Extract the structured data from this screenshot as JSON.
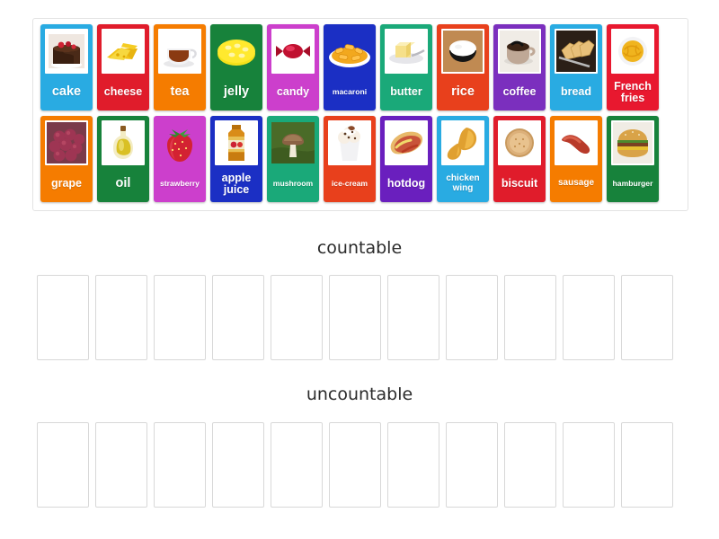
{
  "activity": {
    "type": "group-sort",
    "background_color": "#ffffff"
  },
  "tray": {
    "name": "card-tray",
    "rows": [
      [
        {
          "label": "cake",
          "icon": "cake-icon",
          "color": "#29abe2",
          "label_size": "s-lg",
          "photo_bg": "#ffffff"
        },
        {
          "label": "cheese",
          "icon": "cheese-icon",
          "color": "#e01c2b",
          "label_size": "s-md",
          "photo_bg": "#ffffff"
        },
        {
          "label": "tea",
          "icon": "tea-cup-icon",
          "color": "#f57c00",
          "label_size": "s-lg",
          "photo_bg": "#ffffff"
        },
        {
          "label": "jelly",
          "icon": "jelly-icon",
          "color": "#17823b",
          "label_size": "s-lg",
          "photo_bg": "transparent"
        },
        {
          "label": "candy",
          "icon": "candy-icon",
          "color": "#cc3fcc",
          "label_size": "s-md",
          "photo_bg": "#ffffff"
        },
        {
          "label": "macaroni",
          "icon": "macaroni-icon",
          "color": "#1b2fc4",
          "label_size": "s-xs",
          "photo_bg": "transparent"
        },
        {
          "label": "butter",
          "icon": "butter-icon",
          "color": "#1aa979",
          "label_size": "s-md",
          "photo_bg": "#ffffff"
        },
        {
          "label": "rice",
          "icon": "rice-bowl-icon",
          "color": "#e8401c",
          "label_size": "s-lg",
          "photo_bg": "#ffffff"
        },
        {
          "label": "coffee",
          "icon": "coffee-cup-icon",
          "color": "#7b2fbe",
          "label_size": "s-md",
          "photo_bg": "#ffffff"
        },
        {
          "label": "bread",
          "icon": "bread-icon",
          "color": "#29abe2",
          "label_size": "s-md",
          "photo_bg": "#ffffff"
        },
        {
          "label": "French fries",
          "icon": "french-fries-icon",
          "color": "#e8182f",
          "label_size": "s-md",
          "photo_bg": "#ffffff"
        }
      ],
      [
        {
          "label": "grape",
          "icon": "grape-icon",
          "color": "#f57c00",
          "label_size": "s-md",
          "photo_bg": "#ffffff"
        },
        {
          "label": "oil",
          "icon": "oil-bottle-icon",
          "color": "#17823b",
          "label_size": "s-lg",
          "photo_bg": "#ffffff"
        },
        {
          "label": "strawberry",
          "icon": "strawberry-icon",
          "color": "#cc3fcc",
          "label_size": "s-xs",
          "photo_bg": "transparent"
        },
        {
          "label": "apple juice",
          "icon": "apple-juice-icon",
          "color": "#1b2fc4",
          "label_size": "s-md",
          "photo_bg": "#ffffff"
        },
        {
          "label": "mushroom",
          "icon": "mushroom-icon",
          "color": "#1aa979",
          "label_size": "s-xs",
          "photo_bg": "transparent"
        },
        {
          "label": "ice-cream",
          "icon": "ice-cream-icon",
          "color": "#e8401c",
          "label_size": "s-xs",
          "photo_bg": "#ffffff"
        },
        {
          "label": "hotdog",
          "icon": "hotdog-icon",
          "color": "#6a1fbe",
          "label_size": "s-md",
          "photo_bg": "#ffffff"
        },
        {
          "label": "chicken wing",
          "icon": "chicken-wing-icon",
          "color": "#29abe2",
          "label_size": "s-sm",
          "photo_bg": "#ffffff"
        },
        {
          "label": "biscuit",
          "icon": "biscuit-icon",
          "color": "#e01c2b",
          "label_size": "s-md",
          "photo_bg": "#ffffff"
        },
        {
          "label": "sausage",
          "icon": "sausage-icon",
          "color": "#f57c00",
          "label_size": "s-sm",
          "photo_bg": "#ffffff"
        },
        {
          "label": "hamburger",
          "icon": "hamburger-icon",
          "color": "#17823b",
          "label_size": "s-xs",
          "photo_bg": "#ffffff"
        }
      ]
    ]
  },
  "groups": [
    {
      "title": "countable",
      "slot_count": 11
    },
    {
      "title": "uncountable",
      "slot_count": 11
    }
  ]
}
